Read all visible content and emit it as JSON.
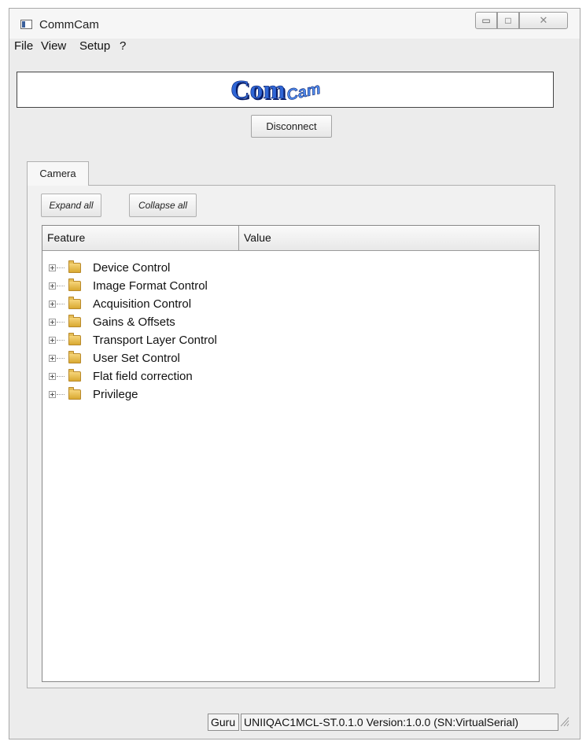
{
  "window": {
    "title": "CommCam",
    "controls": {
      "minimize": "▭",
      "maximize": "□",
      "close": "✕"
    }
  },
  "menubar": {
    "items": [
      {
        "label": "File"
      },
      {
        "label": "View"
      },
      {
        "label": "Setup"
      },
      {
        "label": "?"
      }
    ]
  },
  "banner": {
    "logo_text_main": "Com",
    "logo_text_sub": "Cam"
  },
  "connection": {
    "button_label": "Disconnect"
  },
  "tabs": [
    {
      "label": "Camera"
    }
  ],
  "camera_panel": {
    "expand_label": "Expand all",
    "collapse_label": "Collapse all",
    "tree": {
      "columns": [
        "Feature",
        "Value"
      ],
      "rows": [
        {
          "label": "Device Control"
        },
        {
          "label": "Image Format Control"
        },
        {
          "label": "Acquisition Control"
        },
        {
          "label": "Gains & Offsets"
        },
        {
          "label": "Transport Layer Control"
        },
        {
          "label": "User Set Control"
        },
        {
          "label": "Flat field correction"
        },
        {
          "label": "Privilege"
        }
      ]
    }
  },
  "statusbar": {
    "mode": "Guru",
    "info": "UNIIQAC1MCL-ST.0.1.0 Version:1.0.0 (SN:VirtualSerial)"
  },
  "colors": {
    "logo_blue": "#1f4fbf",
    "logo_shadow": "#0a1f6a",
    "folder": "#e5bd55"
  }
}
